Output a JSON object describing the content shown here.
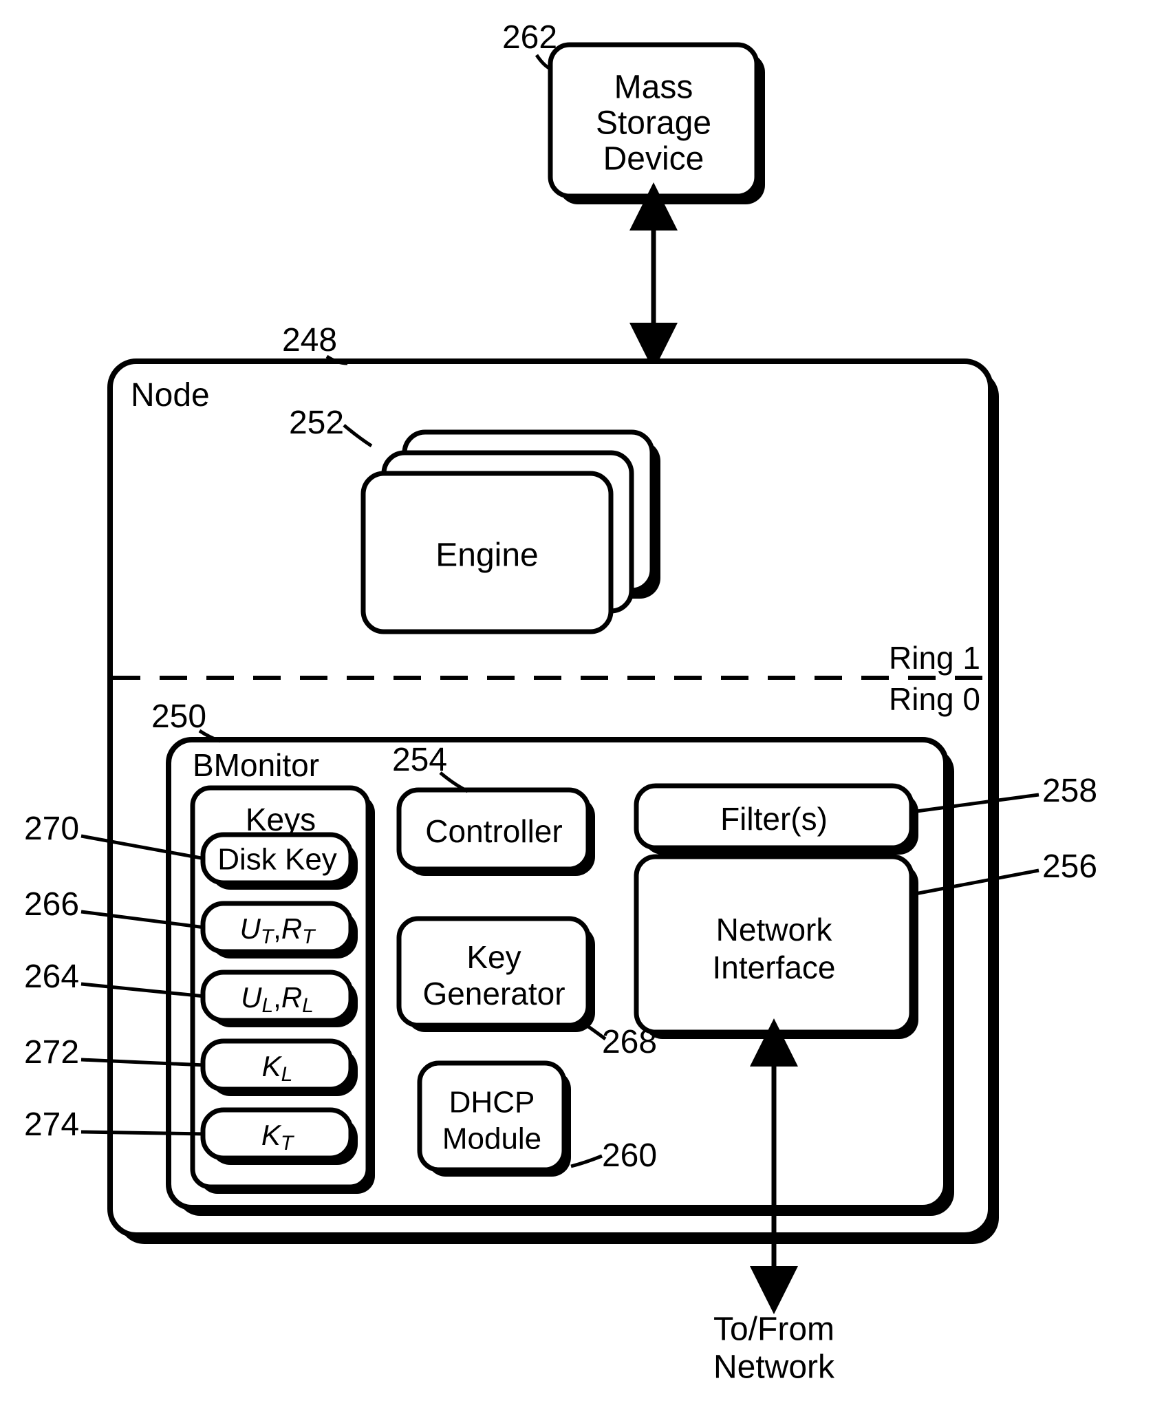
{
  "refs": {
    "massStorage": "262",
    "node": "248",
    "engine": "252",
    "bmonitor": "250",
    "controller": "254",
    "filters": "258",
    "network": "256",
    "keygen": "268",
    "dhcp": "260",
    "diskkey": "270",
    "utrt": "266",
    "ulrl": "264",
    "kl": "272",
    "kt": "274"
  },
  "labels": {
    "massStorage1": "Mass",
    "massStorage2": "Storage",
    "massStorage3": "Device",
    "node": "Node",
    "engine": "Engine",
    "ring1": "Ring 1",
    "ring0": "Ring 0",
    "bmonitor": "BMonitor",
    "keysTitle": "Keys",
    "diskkey": "Disk Key",
    "controller": "Controller",
    "filters": "Filter(s)",
    "network1": "Network",
    "network2": "Interface",
    "keygen1": "Key",
    "keygen2": "Generator",
    "dhcp1": "DHCP",
    "dhcp2": "Module",
    "toFrom1": "To/From",
    "toFrom2": "Network",
    "UT": "U",
    "RT": "R",
    "UL": "U",
    "RL": "R",
    "KL": "K",
    "KT": "K",
    "subT": "T",
    "subL": "L",
    "comma": ","
  }
}
